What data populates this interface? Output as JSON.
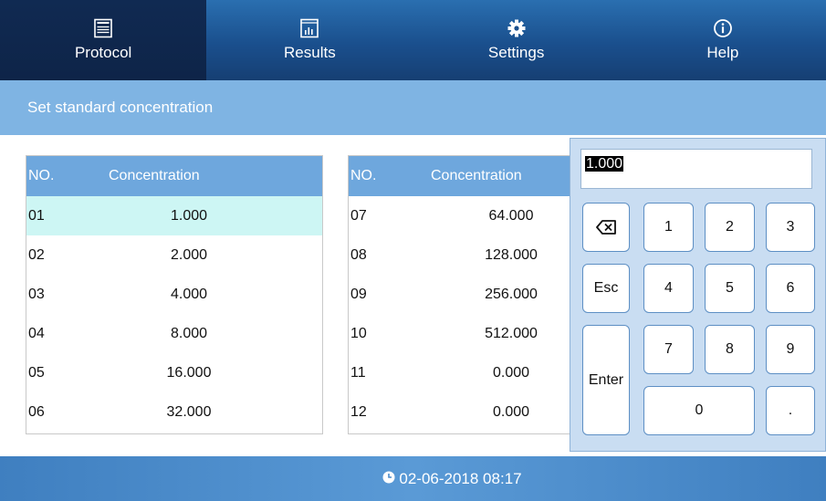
{
  "nav": {
    "items": [
      {
        "label": "Protocol",
        "icon": "protocol-icon",
        "active": true
      },
      {
        "label": "Results",
        "icon": "results-icon",
        "active": false
      },
      {
        "label": "Settings",
        "icon": "settings-icon",
        "active": false
      },
      {
        "label": "Help",
        "icon": "help-icon",
        "active": false
      }
    ]
  },
  "subheader": {
    "title": "Set standard concentration"
  },
  "tables": {
    "left": {
      "headers": [
        "NO.",
        "Concentration"
      ],
      "rows": [
        {
          "no": "01",
          "value": "1.000",
          "selected": true
        },
        {
          "no": "02",
          "value": "2.000"
        },
        {
          "no": "03",
          "value": "4.000"
        },
        {
          "no": "04",
          "value": "8.000"
        },
        {
          "no": "05",
          "value": "16.000"
        },
        {
          "no": "06",
          "value": "32.000"
        }
      ]
    },
    "right": {
      "headers": [
        "NO.",
        "Concentration"
      ],
      "rows": [
        {
          "no": "07",
          "value": "64.000"
        },
        {
          "no": "08",
          "value": "128.000"
        },
        {
          "no": "09",
          "value": "256.000"
        },
        {
          "no": "10",
          "value": "512.000"
        },
        {
          "no": "11",
          "value": "0.000"
        },
        {
          "no": "12",
          "value": "0.000"
        }
      ]
    }
  },
  "keypad": {
    "display": "1.000",
    "keys": {
      "backspace": "backspace-icon",
      "esc": "Esc",
      "enter": "Enter",
      "k1": "1",
      "k2": "2",
      "k3": "3",
      "k4": "4",
      "k5": "5",
      "k6": "6",
      "k7": "7",
      "k8": "8",
      "k9": "9",
      "k0": "0",
      "dot": "."
    }
  },
  "footer": {
    "datetime": "02-06-2018 08:17",
    "icon": "clock-icon"
  },
  "colors": {
    "nav_bg": "#1a4f8d",
    "nav_active": "#102a52",
    "subheader": "#7fb4e3",
    "table_header": "#6ea7dd",
    "selected_row": "#cdf6f4",
    "keypad_bg": "#c9ddf2",
    "footer": "#4a8ccb"
  }
}
